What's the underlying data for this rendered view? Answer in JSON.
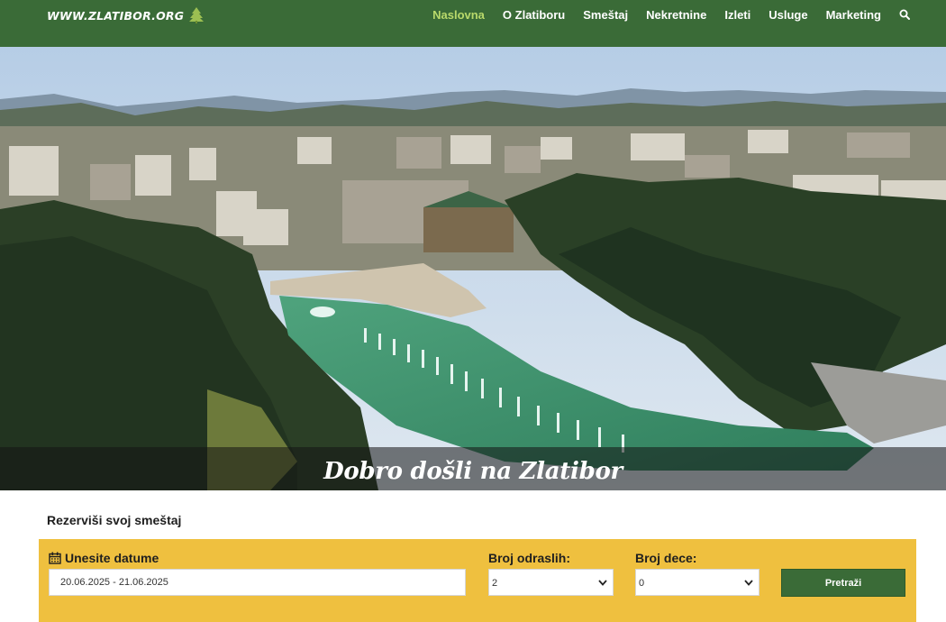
{
  "header": {
    "logo_text": "WWW.ZLATIBOR.ORG",
    "menu": [
      {
        "label": "Naslovna",
        "active": true
      },
      {
        "label": "O Zlatiboru",
        "active": false
      },
      {
        "label": "Smeštaj",
        "active": false
      },
      {
        "label": "Nekretnine",
        "active": false
      },
      {
        "label": "Izleti",
        "active": false
      },
      {
        "label": "Usluge",
        "active": false
      },
      {
        "label": "Marketing",
        "active": false
      }
    ],
    "search_icon": "search-icon"
  },
  "hero": {
    "caption": "Dobro došli na Zlatibor"
  },
  "booking": {
    "title": "Rezerviši svoj smeštaj",
    "dates_label": "Unesite datume",
    "dates_value": "20.06.2025 - 21.06.2025",
    "adults_label": "Broj odraslih:",
    "adults_value": "2",
    "children_label": "Broj dece:",
    "children_value": "0",
    "search_button": "Pretraži"
  },
  "colors": {
    "nav_bg": "#3a6b37",
    "active_link": "#b9d96b",
    "booking_bg": "#efc03f",
    "button_bg": "#3a6b37"
  }
}
